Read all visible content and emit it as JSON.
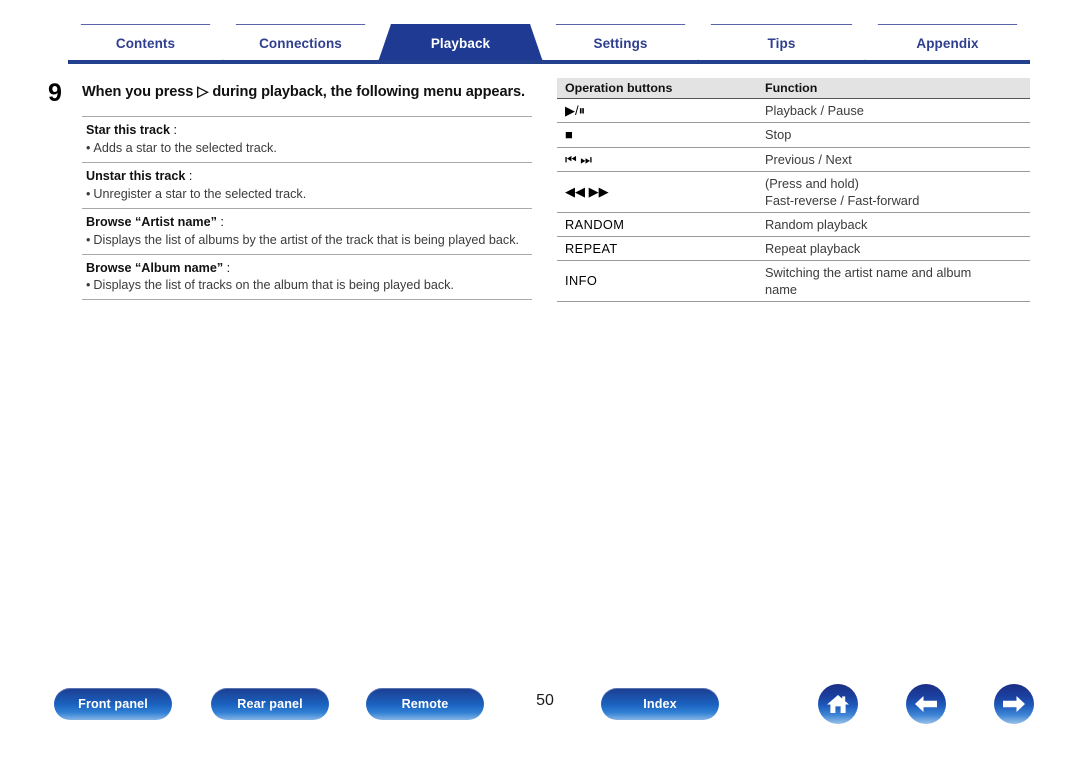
{
  "tabs": [
    {
      "label": "Contents",
      "active": false
    },
    {
      "label": "Connections",
      "active": false
    },
    {
      "label": "Playback",
      "active": true
    },
    {
      "label": "Settings",
      "active": false
    },
    {
      "label": "Tips",
      "active": false
    },
    {
      "label": "Appendix",
      "active": false
    }
  ],
  "step": {
    "number": "9",
    "title": "When you press ▷ during playback, the following menu appears."
  },
  "definitions": [
    {
      "term": "Star this track",
      "colon": ":",
      "bullet": "•",
      "desc": "Adds a star to the selected track.",
      "justify": false
    },
    {
      "term": "Unstar this track",
      "colon": ":",
      "bullet": "•",
      "desc": "Unregister a star to the selected track.",
      "justify": false
    },
    {
      "term": "Browse “Artist name”",
      "colon": ":",
      "bullet": "•",
      "desc": "Displays the list of albums by the artist of the track that is being played back.",
      "justify": true
    },
    {
      "term": "Browse “Album name”",
      "colon": ":",
      "bullet": "•",
      "desc": "Displays the list of tracks on the album that is being played back.",
      "justify": false
    }
  ],
  "table": {
    "headers": [
      "Operation buttons",
      "Function"
    ],
    "rows": [
      {
        "button": "▶/⏸",
        "button_name": "play-pause-button",
        "function_line1": "Playback / Pause",
        "function_line2": ""
      },
      {
        "button": "■",
        "button_name": "stop-button",
        "function_line1": "Stop",
        "function_line2": ""
      },
      {
        "button": "⏮ ⏭",
        "button_name": "previous-next-button",
        "function_line1": "Previous / Next",
        "function_line2": ""
      },
      {
        "button": "◀◀ ▶▶",
        "button_name": "fast-reverse-forward-button",
        "function_line1": "(Press and hold)",
        "function_line2": "Fast-reverse / Fast-forward"
      },
      {
        "button": "RANDOM",
        "button_name": "random-button",
        "function_line1": "Random playback",
        "function_line2": ""
      },
      {
        "button": "REPEAT",
        "button_name": "repeat-button",
        "function_line1": "Repeat playback",
        "function_line2": ""
      },
      {
        "button": "INFO",
        "button_name": "info-button",
        "function_line1": "Switching the artist name and album",
        "function_line2": "name"
      }
    ]
  },
  "footer": {
    "buttons": [
      {
        "label": "Front panel",
        "name": "front-panel-button"
      },
      {
        "label": "Rear panel",
        "name": "rear-panel-button"
      },
      {
        "label": "Remote",
        "name": "remote-button"
      },
      {
        "label": "Index",
        "name": "index-button"
      }
    ],
    "page_number": "50",
    "icons": [
      {
        "name": "home-icon"
      },
      {
        "name": "arrow-left-icon"
      },
      {
        "name": "arrow-right-icon"
      }
    ]
  },
  "colors": {
    "tab_active_bg": "#1f3a93",
    "tab_text": "#2f3f8f",
    "rule": "#23408e",
    "table_header_bg": "#e3e3e3"
  }
}
